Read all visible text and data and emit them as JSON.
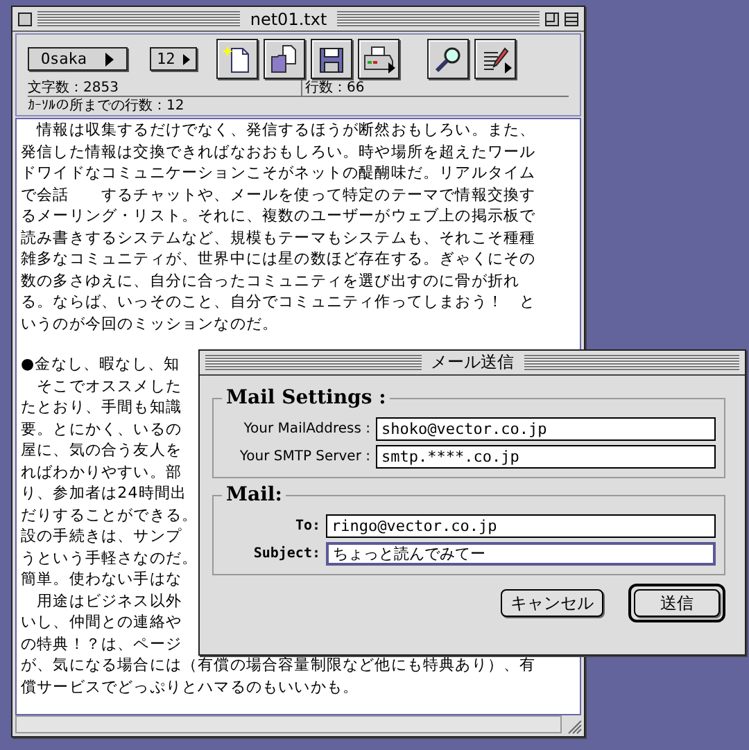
{
  "window": {
    "title": "net01.txt"
  },
  "toolbar": {
    "font": "Osaka",
    "size": "12",
    "tools": [
      {
        "kind": "new",
        "has_menu": false
      },
      {
        "kind": "open",
        "has_menu": false
      },
      {
        "kind": "save",
        "has_menu": false
      },
      {
        "kind": "print",
        "has_menu": true
      },
      {
        "kind": "find",
        "has_menu": false
      },
      {
        "kind": "edit",
        "has_menu": true
      }
    ]
  },
  "status": {
    "char_count": "文字数：2853",
    "line_count": "行数：66",
    "cursor_line": "ｶｰｿﾙの所までの行数：12"
  },
  "document": {
    "paragraphs": [
      {
        "lines": [
          "　情報は収集するだけでなく、発信するほうが断然おもしろい。また、",
          "発信した情報は交換できればなおおもしろい。時や場所を超えたワール",
          "ドワイドなコミュニケーションこそがネットの醍醐味だ。リアルタイム",
          "で会話　　するチャットや、メールを使って特定のテーマで情報交換す",
          "るメーリング・リスト。それに、複数のユーザーがウェブ上の掲示板で",
          "読み書きするシステムなど、規模もテーマもシステムも、それこそ種種",
          "雑多なコミュニティが、世界中には星の数ほど存在する。ぎゃくにその",
          "数の多さゆえに、自分に合ったコミュニティを選び出すのに骨が折れ",
          "る。ならば、いっそのこと、自分でコミュニティ作ってしまおう！　と",
          "いうのが今回のミッションなのだ。"
        ]
      },
      {
        "lines": [
          "●金なし、暇なし、知",
          "　そこでオススメした",
          "たとおり、手間も知識",
          "要。とにかく、いるの",
          "屋に、気の合う友人を",
          "ればわかりやすい。部",
          "り、参加者は24時間出",
          "だりすることができる。",
          "設の手続きは、サンプ",
          "うという手軽さなのだ。",
          "簡単。使わない手はな",
          "　用途はビジネス以外",
          "いし、仲間との連絡や",
          "の特典！？は、ページ",
          "が、気になる場合には（有償の場合容量制限など他にも特典あり）、有",
          "償サービスでどっぷりとハマるのもいいかも。"
        ]
      }
    ]
  },
  "dialog": {
    "title": "メール送信",
    "groups": [
      {
        "title": "Mail Settings :",
        "kind": "settings",
        "fields": [
          {
            "label": "Your MailAddress :",
            "value": "shoko@vector.co.jp",
            "focused": false
          },
          {
            "label": "Your SMTP Server :",
            "value": "smtp.****.co.jp",
            "focused": false
          }
        ]
      },
      {
        "title": "Mail:",
        "kind": "message",
        "fields": [
          {
            "label": "To:",
            "value": "ringo@vector.co.jp",
            "focused": false
          },
          {
            "label": "Subject:",
            "value": "ちょっと読んでみてー",
            "focused": true
          }
        ]
      }
    ],
    "buttons": [
      {
        "label": "キャンセル",
        "default": false
      },
      {
        "label": "送信",
        "default": true
      }
    ]
  }
}
